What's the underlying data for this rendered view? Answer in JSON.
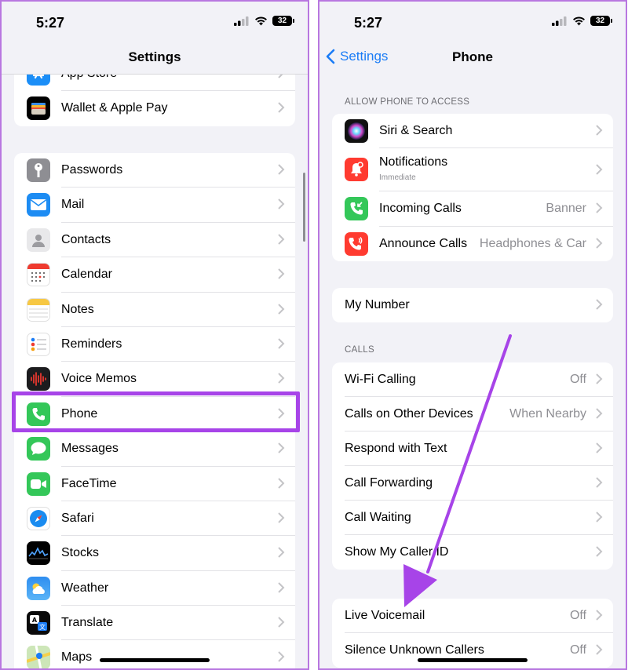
{
  "left": {
    "status": {
      "time": "5:27",
      "battery": "32"
    },
    "nav": {
      "title": "Settings"
    },
    "top_group": [
      {
        "label": "App Store",
        "icon": "app-store-icon"
      },
      {
        "label": "Wallet & Apple Pay",
        "icon": "wallet-icon"
      }
    ],
    "apps_group": [
      {
        "label": "Passwords",
        "icon": "key-icon"
      },
      {
        "label": "Mail",
        "icon": "mail-icon"
      },
      {
        "label": "Contacts",
        "icon": "contacts-icon"
      },
      {
        "label": "Calendar",
        "icon": "calendar-icon"
      },
      {
        "label": "Notes",
        "icon": "notes-icon"
      },
      {
        "label": "Reminders",
        "icon": "reminders-icon"
      },
      {
        "label": "Voice Memos",
        "icon": "voice-memos-icon"
      },
      {
        "label": "Phone",
        "icon": "phone-icon"
      },
      {
        "label": "Messages",
        "icon": "messages-icon"
      },
      {
        "label": "FaceTime",
        "icon": "facetime-icon"
      },
      {
        "label": "Safari",
        "icon": "safari-icon"
      },
      {
        "label": "Stocks",
        "icon": "stocks-icon"
      },
      {
        "label": "Weather",
        "icon": "weather-icon"
      },
      {
        "label": "Translate",
        "icon": "translate-icon"
      },
      {
        "label": "Maps",
        "icon": "maps-icon"
      }
    ]
  },
  "right": {
    "status": {
      "time": "5:27",
      "battery": "32"
    },
    "nav": {
      "back": "Settings",
      "title": "Phone"
    },
    "access": {
      "header": "ALLOW PHONE TO ACCESS",
      "items": [
        {
          "label": "Siri & Search",
          "value": "",
          "icon": "siri-icon"
        },
        {
          "label": "Notifications",
          "sub": "Immediate",
          "value": "",
          "icon": "notifications-icon"
        },
        {
          "label": "Incoming Calls",
          "value": "Banner",
          "icon": "incoming-calls-icon"
        },
        {
          "label": "Announce Calls",
          "value": "Headphones & Car",
          "icon": "announce-calls-icon"
        }
      ]
    },
    "my_number": {
      "label": "My Number"
    },
    "calls": {
      "header": "CALLS",
      "items": [
        {
          "label": "Wi-Fi Calling",
          "value": "Off"
        },
        {
          "label": "Calls on Other Devices",
          "value": "When Nearby"
        },
        {
          "label": "Respond with Text",
          "value": ""
        },
        {
          "label": "Call Forwarding",
          "value": ""
        },
        {
          "label": "Call Waiting",
          "value": ""
        },
        {
          "label": "Show My Caller ID",
          "value": ""
        }
      ]
    },
    "voicemail": {
      "items": [
        {
          "label": "Live Voicemail",
          "value": "Off"
        },
        {
          "label": "Silence Unknown Callers",
          "value": "Off"
        }
      ]
    }
  },
  "colors": {
    "accent": "#1a7cf6",
    "highlight": "#a744e8",
    "frame": "#b877e0"
  }
}
